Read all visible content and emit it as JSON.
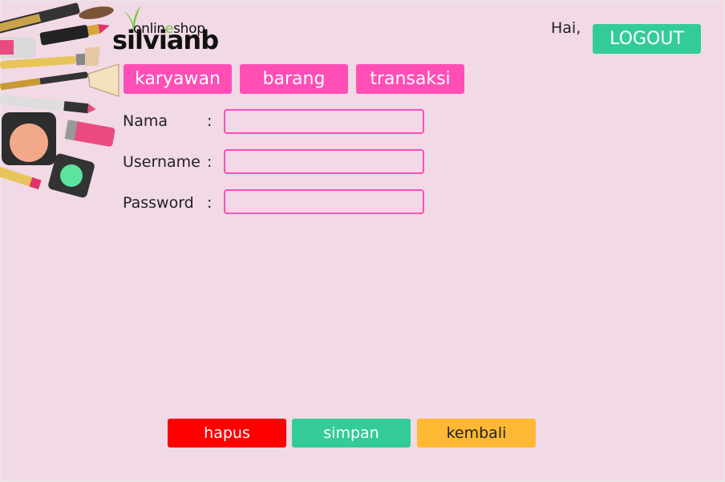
{
  "brand": {
    "tagline_a": "onlin",
    "tagline_e": "e",
    "tagline_b": "shop",
    "name": "silvianb"
  },
  "header": {
    "greeting": "Hai,",
    "logout_label": "LOGOUT"
  },
  "nav": {
    "karyawan": "karyawan",
    "barang": "barang",
    "transaksi": "transaksi"
  },
  "form": {
    "nama_label": "Nama",
    "username_label": "Username",
    "password_label": "Password",
    "colon": ":",
    "nama_value": "",
    "username_value": "",
    "password_value": ""
  },
  "actions": {
    "hapus": "hapus",
    "simpan": "simpan",
    "kembali": "kembali"
  },
  "colors": {
    "background": "#f2d9e6",
    "nav": "#ff4fb6",
    "logout": "#33cc99",
    "hapus": "#ff0000",
    "simpan": "#33cc99",
    "kembali": "#ffb833"
  },
  "icons": [
    "makeup-illustration",
    "leaf-logo-icon"
  ]
}
